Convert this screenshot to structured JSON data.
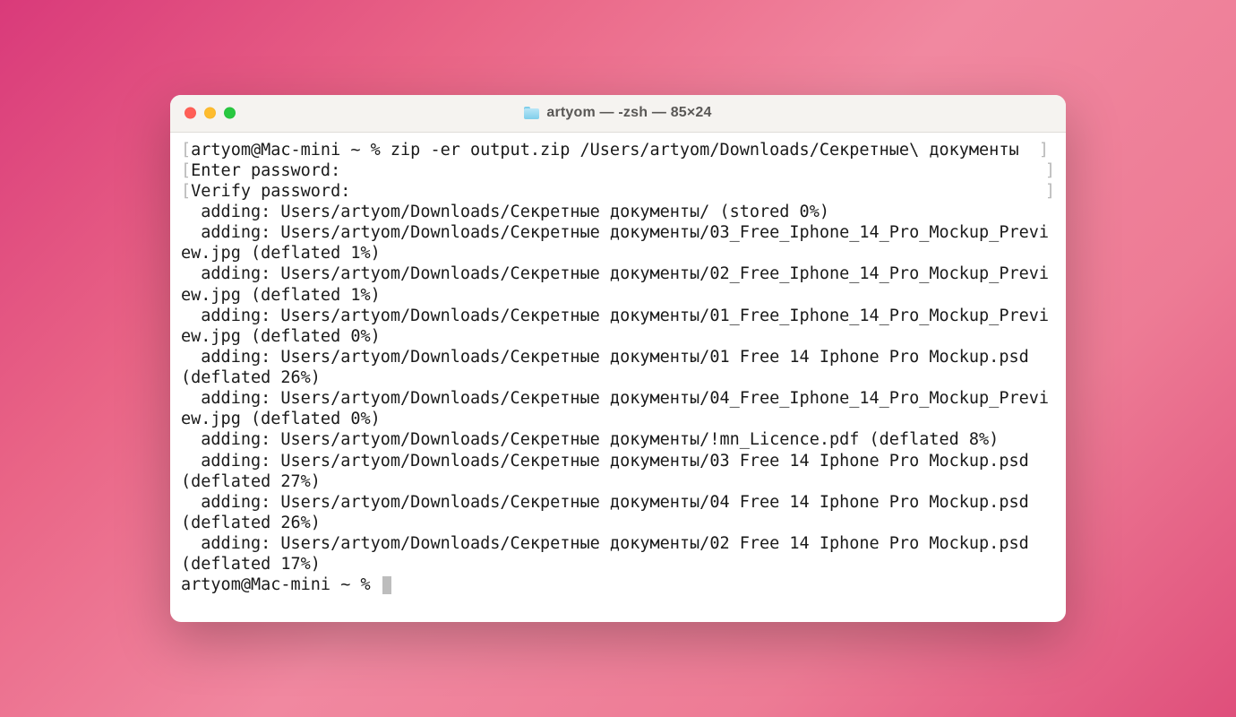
{
  "window": {
    "title": "artyom — -zsh — 85×24"
  },
  "terminal": {
    "prompt_line": "artyom@Mac-mini ~ % zip -er output.zip /Users/artyom/Downloads/Секретные\\ документы  ",
    "bracket_lines": [
      "Enter password: ",
      "Verify password: "
    ],
    "body": "  adding: Users/artyom/Downloads/Секретные документы/ (stored 0%)\n  adding: Users/artyom/Downloads/Секретные документы/03_Free_Iphone_14_Pro_Mockup_Preview.jpg (deflated 1%)\n  adding: Users/artyom/Downloads/Секретные документы/02_Free_Iphone_14_Pro_Mockup_Preview.jpg (deflated 1%)\n  adding: Users/artyom/Downloads/Секретные документы/01_Free_Iphone_14_Pro_Mockup_Preview.jpg (deflated 0%)\n  adding: Users/artyom/Downloads/Секретные документы/01 Free 14 Iphone Pro Mockup.psd (deflated 26%)\n  adding: Users/artyom/Downloads/Секретные документы/04_Free_Iphone_14_Pro_Mockup_Preview.jpg (deflated 0%)\n  adding: Users/artyom/Downloads/Секретные документы/!mn_Licence.pdf (deflated 8%)\n  adding: Users/artyom/Downloads/Секретные документы/03 Free 14 Iphone Pro Mockup.psd (deflated 27%)\n  adding: Users/artyom/Downloads/Секретные документы/04 Free 14 Iphone Pro Mockup.psd (deflated 26%)\n  adding: Users/artyom/Downloads/Секретные документы/02 Free 14 Iphone Pro Mockup.psd (deflated 17%)",
    "final_prompt": "artyom@Mac-mini ~ % "
  }
}
